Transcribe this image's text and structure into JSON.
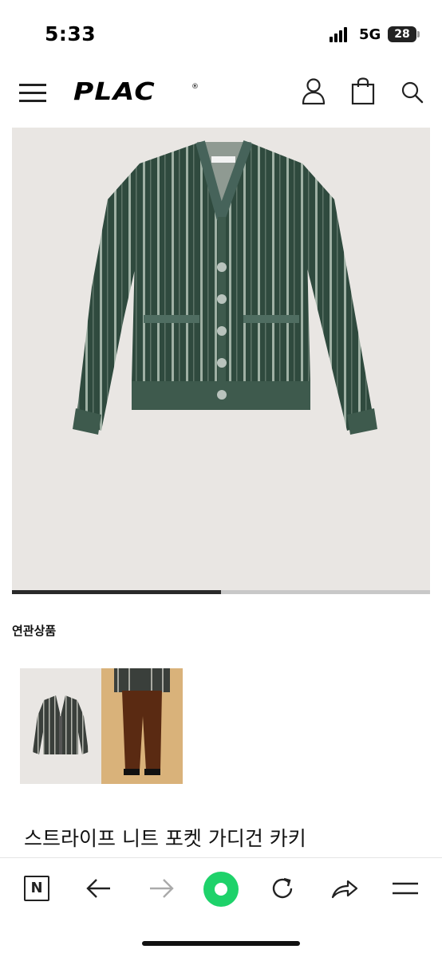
{
  "status_bar": {
    "time": "5:33",
    "network": "5G",
    "battery": "28"
  },
  "header": {
    "logo": "PLAC",
    "logo_mark": "®",
    "menu_icon": "hamburger-menu-icon",
    "account_icon": "user-icon",
    "cart_icon": "shopping-bag-icon",
    "search_icon": "search-icon"
  },
  "hero": {
    "carousel_progress": 0.5
  },
  "related": {
    "title": "연관상품"
  },
  "product": {
    "name": "스트라이프 니트 포켓 가디건 카키"
  },
  "toolbar": {
    "naver_label": "N",
    "icons": [
      "naver-icon",
      "back-arrow-icon",
      "forward-arrow-icon",
      "green-home-icon",
      "refresh-icon",
      "share-icon",
      "menu-icon"
    ]
  },
  "colors": {
    "accent_green": "#1ed26a",
    "cardigan_green": "#2f4a3e",
    "hero_bg": "#e9e6e3"
  }
}
